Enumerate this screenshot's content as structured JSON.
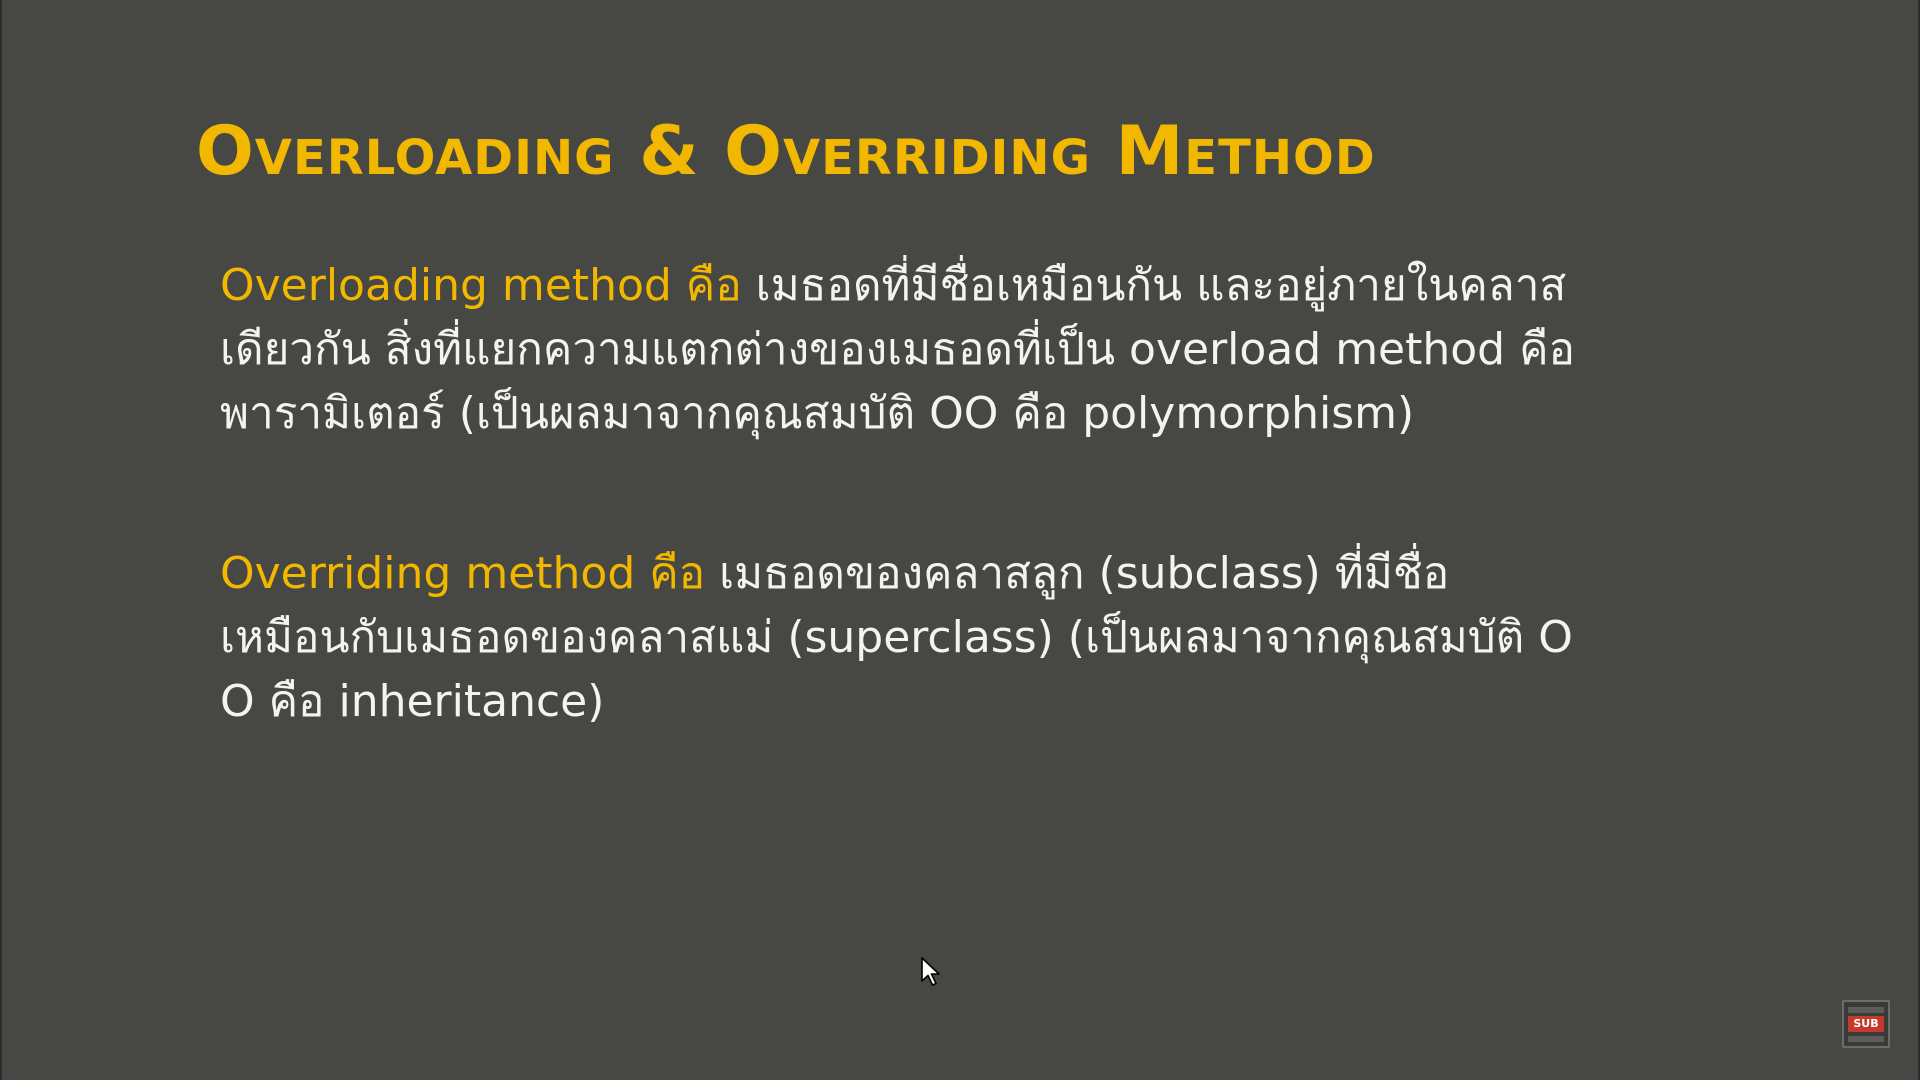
{
  "slide": {
    "title": "Overloading & Overriding Method",
    "paragraphs": [
      {
        "term": "Overloading method คือ",
        "lines": [
          " เมธอดที่มีชื่อเหมือนกัน และอยู่ภายในคลาส",
          "เดียวกัน สิ่งที่แยกความแตกต่างของเมธอดที่เป็น overload method คือ",
          "พารามิเตอร์ (เป็นผลมาจากคุณสมบัติ OO คือ polymorphism)"
        ]
      },
      {
        "term": "Overriding method คือ",
        "lines": [
          " เมธอดของคลาสลูก (subclass) ที่มีชื่อ",
          "เหมือนกับเมธอดของคลาสแม่ (superclass) (เป็นผลมาจากคุณสมบัติ O",
          "O คือ inheritance)"
        ]
      }
    ]
  },
  "overlay": {
    "badge_label": "SUB",
    "cursor_icon": "mouse-pointer-icon"
  },
  "colors": {
    "background": "#474744",
    "accent": "#f2b800",
    "text": "#f3f3f3",
    "badge_red": "#c53a2c"
  }
}
